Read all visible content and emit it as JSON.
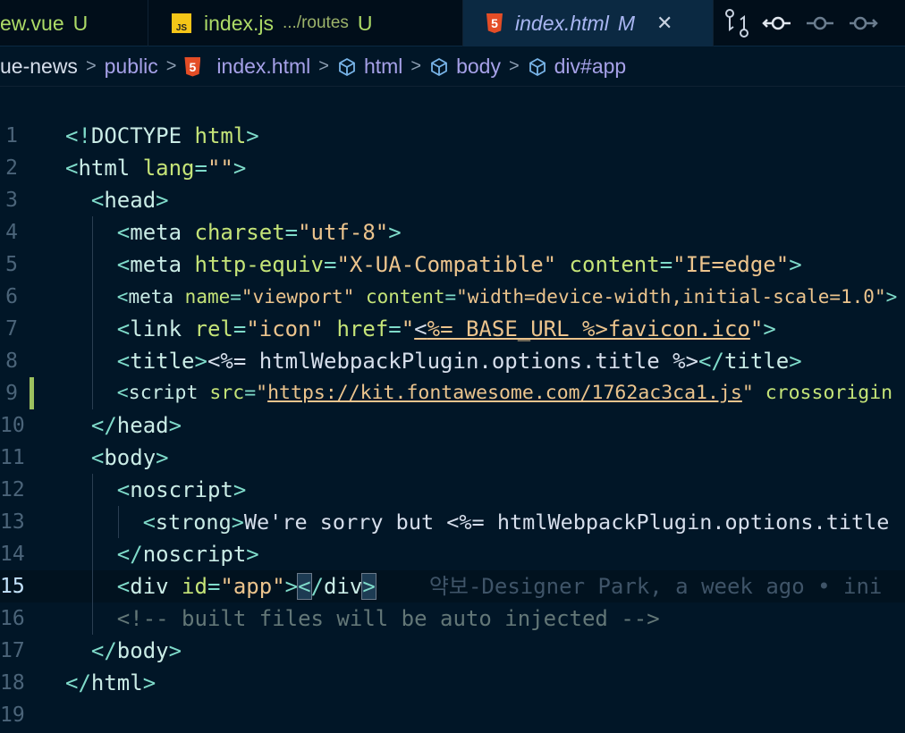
{
  "tabs": [
    {
      "label": "ew.vue",
      "status": "U"
    },
    {
      "label": "index.js",
      "path": ".../routes",
      "status": "U",
      "icon": "js-icon"
    },
    {
      "label": "index.html",
      "status": "M",
      "icon": "html5-icon",
      "active": true
    }
  ],
  "breadcrumb": [
    "ue-news",
    "public",
    "index.html",
    "html",
    "body",
    "div#app"
  ],
  "blame": "약보-Designer Park, a week ago • ini",
  "current_line": 15,
  "colors": {
    "background": "#011627",
    "punct": "#7fdbca",
    "tag": "#caece6",
    "attr": "#c5e478",
    "string": "#ecc48d",
    "comment": "#637777"
  },
  "lines": [
    {
      "n": "1",
      "indent": 0,
      "tokens": [
        [
          "p",
          "<!"
        ],
        [
          "t",
          "DOCTYPE "
        ],
        [
          "a",
          "html"
        ],
        [
          "p",
          ">"
        ]
      ]
    },
    {
      "n": "2",
      "indent": 0,
      "tokens": [
        [
          "p",
          "<"
        ],
        [
          "t",
          "html "
        ],
        [
          "a",
          "lang"
        ],
        [
          "p",
          "="
        ],
        [
          "s",
          "\"\""
        ],
        [
          "p",
          ">"
        ]
      ]
    },
    {
      "n": "3",
      "indent": 1,
      "tokens": [
        [
          "p",
          "<"
        ],
        [
          "t",
          "head"
        ],
        [
          "p",
          ">"
        ]
      ]
    },
    {
      "n": "4",
      "indent": 2,
      "tokens": [
        [
          "p",
          "<"
        ],
        [
          "t",
          "meta "
        ],
        [
          "a",
          "charset"
        ],
        [
          "p",
          "="
        ],
        [
          "s",
          "\"utf-8\""
        ],
        [
          "p",
          ">"
        ]
      ]
    },
    {
      "n": "5",
      "indent": 2,
      "tokens": [
        [
          "p",
          "<"
        ],
        [
          "t",
          "meta "
        ],
        [
          "a",
          "http-equiv"
        ],
        [
          "p",
          "="
        ],
        [
          "s",
          "\"X-UA-Compatible\" "
        ],
        [
          "a",
          "content"
        ],
        [
          "p",
          "="
        ],
        [
          "s",
          "\"IE=edge\""
        ],
        [
          "p",
          ">"
        ]
      ]
    },
    {
      "n": "6",
      "indent": 2,
      "tokens": [
        [
          "p",
          "<"
        ],
        [
          "t",
          "meta "
        ],
        [
          "a",
          "name"
        ],
        [
          "p",
          "="
        ],
        [
          "s",
          "\"viewport\" "
        ],
        [
          "a",
          "content"
        ],
        [
          "p",
          "="
        ],
        [
          "s",
          "\"width=device-width,initial-scale=1.0\""
        ],
        [
          "p",
          ">"
        ]
      ]
    },
    {
      "n": "7",
      "indent": 2,
      "tokens": [
        [
          "p",
          "<"
        ],
        [
          "t",
          "link "
        ],
        [
          "a",
          "rel"
        ],
        [
          "p",
          "="
        ],
        [
          "s",
          "\"icon\" "
        ],
        [
          "a",
          "href"
        ],
        [
          "p",
          "="
        ],
        [
          "s",
          "\""
        ],
        [
          "xu",
          "<"
        ],
        [
          "su",
          "%= BASE_URL %>favicon.ico"
        ],
        [
          "s",
          "\""
        ],
        [
          "p",
          ">"
        ]
      ]
    },
    {
      "n": "8",
      "indent": 2,
      "tokens": [
        [
          "p",
          "<"
        ],
        [
          "t",
          "title"
        ],
        [
          "p",
          ">"
        ],
        [
          "x",
          "<%= htmlWebpackPlugin.options.title %>"
        ],
        [
          "p",
          "</"
        ],
        [
          "t",
          "title"
        ],
        [
          "p",
          ">"
        ]
      ]
    },
    {
      "n": "9",
      "indent": 2,
      "gutter": true,
      "tokens": [
        [
          "p",
          "<"
        ],
        [
          "t",
          "script "
        ],
        [
          "a",
          "src"
        ],
        [
          "p",
          "="
        ],
        [
          "s",
          "\""
        ],
        [
          "su",
          "https://kit.fontawesome.com/1762ac3ca1.js"
        ],
        [
          "s",
          "\" "
        ],
        [
          "a",
          "crossorigin"
        ]
      ]
    },
    {
      "n": "10",
      "indent": 1,
      "tokens": [
        [
          "p",
          "</"
        ],
        [
          "t",
          "head"
        ],
        [
          "p",
          ">"
        ]
      ]
    },
    {
      "n": "11",
      "indent": 1,
      "tokens": [
        [
          "p",
          "<"
        ],
        [
          "t",
          "body"
        ],
        [
          "p",
          ">"
        ]
      ]
    },
    {
      "n": "12",
      "indent": 2,
      "tokens": [
        [
          "p",
          "<"
        ],
        [
          "t",
          "noscript"
        ],
        [
          "p",
          ">"
        ]
      ]
    },
    {
      "n": "13",
      "indent": 3,
      "tokens": [
        [
          "p",
          "<"
        ],
        [
          "t",
          "strong"
        ],
        [
          "p",
          ">"
        ],
        [
          "x",
          "We're sorry but <%= htmlWebpackPlugin.options.title"
        ]
      ]
    },
    {
      "n": "14",
      "indent": 2,
      "tokens": [
        [
          "p",
          "</"
        ],
        [
          "t",
          "noscript"
        ],
        [
          "p",
          ">"
        ]
      ]
    },
    {
      "n": "15",
      "indent": 2,
      "current": true,
      "tokens": [
        [
          "p",
          "<"
        ],
        [
          "t",
          "div "
        ],
        [
          "a",
          "id"
        ],
        [
          "p",
          "="
        ],
        [
          "s",
          "\"app\""
        ],
        [
          "p",
          ">"
        ],
        [
          "pb",
          "<"
        ],
        [
          "p",
          "/"
        ],
        [
          "t",
          "div"
        ],
        [
          "pb",
          ">"
        ]
      ]
    },
    {
      "n": "16",
      "indent": 2,
      "tokens": [
        [
          "c",
          "<!-- built files will be auto injected -->"
        ]
      ]
    },
    {
      "n": "17",
      "indent": 1,
      "tokens": [
        [
          "p",
          "</"
        ],
        [
          "t",
          "body"
        ],
        [
          "p",
          ">"
        ]
      ]
    },
    {
      "n": "18",
      "indent": 0,
      "tokens": [
        [
          "p",
          "</"
        ],
        [
          "t",
          "html"
        ],
        [
          "p",
          ">"
        ]
      ]
    },
    {
      "n": "19",
      "indent": 0,
      "tokens": []
    }
  ]
}
